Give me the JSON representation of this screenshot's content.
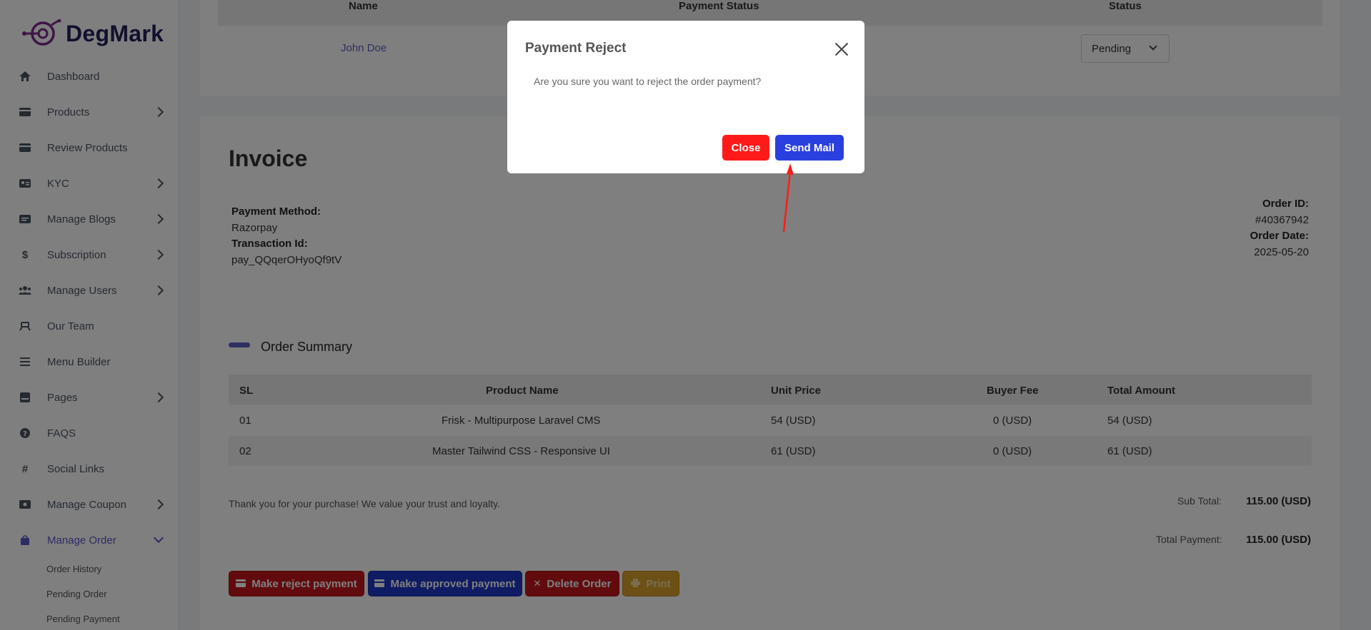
{
  "app": {
    "brand": "DegMark"
  },
  "sidebar": {
    "items": [
      {
        "label": "Dashboard",
        "icon": "home-icon"
      },
      {
        "label": "Products",
        "icon": "card-icon"
      },
      {
        "label": "Review Products",
        "icon": "card-icon"
      },
      {
        "label": "KYC",
        "icon": "id-card-icon"
      },
      {
        "label": "Manage Blogs",
        "icon": "blog-icon"
      },
      {
        "label": "Subscription",
        "icon": "dollar-icon"
      },
      {
        "label": "Manage Users",
        "icon": "users-icon"
      },
      {
        "label": "Our Team",
        "icon": "team-icon"
      },
      {
        "label": "Menu Builder",
        "icon": "menu-icon"
      },
      {
        "label": "Pages",
        "icon": "pages-icon"
      },
      {
        "label": "FAQS",
        "icon": "question-icon"
      },
      {
        "label": "Social Links",
        "icon": "hash-icon"
      },
      {
        "label": "Manage Coupon",
        "icon": "coupon-icon"
      },
      {
        "label": "Manage Order",
        "icon": "bag-icon"
      }
    ],
    "sub_items": [
      "Order History",
      "Pending Order",
      "Pending Payment"
    ],
    "accent": "#5858c8"
  },
  "top_table": {
    "headers": [
      "Name",
      "Payment Status",
      "Status"
    ],
    "name": "John Doe",
    "status_select": "Pending"
  },
  "invoice": {
    "title": "Invoice",
    "payment_method_label": "Payment Method:",
    "payment_method": "Razorpay",
    "transaction_label": "Transaction Id:",
    "transaction_id": "pay_QQqerOHyoQf9tV",
    "order_id_label": "Order ID:",
    "order_id": "#40367942",
    "order_date_label": "Order Date:",
    "order_date": "2025-05-20"
  },
  "order_summary": {
    "title": "Order Summary",
    "headers": [
      "SL",
      "Product Name",
      "Unit Price",
      "Buyer Fee",
      "Total Amount"
    ],
    "rows": [
      {
        "sl": "01",
        "product": "Frisk - Multipurpose Laravel CMS",
        "unit_price": "54 (USD)",
        "buyer_fee": "0 (USD)",
        "total": "54 (USD)"
      },
      {
        "sl": "02",
        "product": "Master Tailwind CSS - Responsive UI",
        "unit_price": "61 (USD)",
        "buyer_fee": "0 (USD)",
        "total": "61 (USD)"
      }
    ],
    "thank_you": "Thank you for your purchase! We value your trust and loyalty.",
    "sub_total_label": "Sub Total:",
    "sub_total": "115.00 (USD)",
    "total_payment_label": "Total Payment:",
    "total_payment": "115.00 (USD)"
  },
  "actions": {
    "reject": "Make reject payment",
    "approve": "Make approved payment",
    "delete": "Delete Order",
    "print": "Print"
  },
  "modal": {
    "title": "Payment Reject",
    "body": "Are you sure you want to reject the order payment?",
    "close": "Close",
    "send": "Send Mail"
  },
  "colors": {
    "red": "#ff1a1a",
    "blue": "#2a3fe0",
    "yellow": "#f1b32e",
    "reject_btn": "#c4161c",
    "approve_btn": "#1e37c6"
  }
}
